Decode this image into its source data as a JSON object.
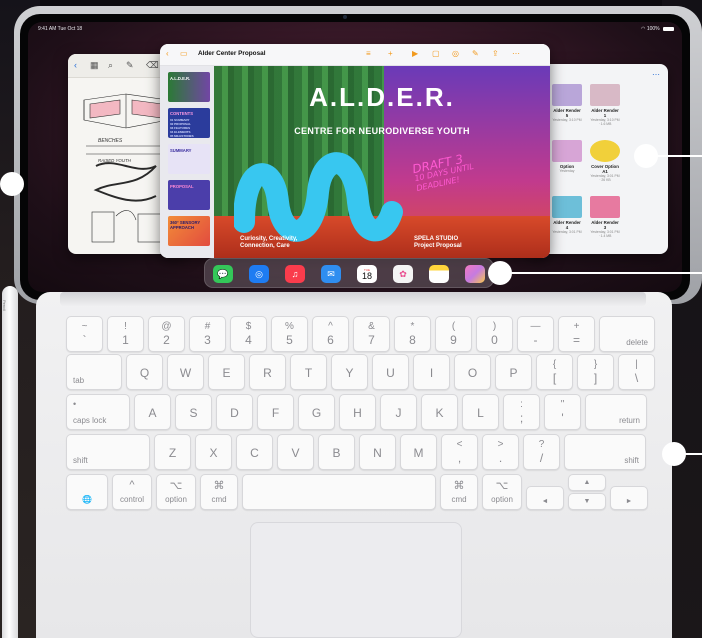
{
  "status_bar": {
    "time": "9:41 AM  Tue Oct 18",
    "battery": "100%"
  },
  "keynote": {
    "title": "Alder Center Proposal",
    "title_badge": "",
    "sidebar": [
      {
        "label": "A.L.D.E.R."
      },
      {
        "label": "CONTENTS",
        "lines": [
          "01 SUMMARY",
          "02 PROPOSAL",
          "03 FEATURES",
          "04 ELEMENTS",
          "05 MILESTONES"
        ]
      },
      {
        "label": "SUMMARY"
      },
      {
        "label": "PROPOSAL"
      },
      {
        "label": "360° SENSORY APPROACH"
      }
    ],
    "slide": {
      "logo": "A.L.D.E.R.",
      "subtitle": "CENTRE FOR NEURODIVERSE YOUTH",
      "draft_lines": [
        "DRAFT 3",
        "10 DAYS UNTIL",
        "DEADLINE!"
      ],
      "left_caption": [
        "Curiosity, Creativity,",
        "Connection, Care"
      ],
      "right_caption": [
        "SPELA STUDIO",
        "Project Proposal"
      ]
    }
  },
  "files": [
    {
      "name": "Alder Render 1",
      "meta": "Yesterday, 3:10 PM · 1.6 MB",
      "color": "#d8b9c6"
    },
    {
      "name": "Alder Render 5",
      "meta": "Yesterday, 3:10 PM",
      "color": "#b9a6d9"
    },
    {
      "name": "Cover Option A1",
      "meta": "Yesterday, 3:01 PM · 26 KB",
      "color": "#f1d03a"
    },
    {
      "name": "Alder Render 3",
      "meta": "Yesterday, 3:01 PM · 1.4 MB",
      "color": "#e77aa0"
    },
    {
      "name": "Alder Render 4",
      "meta": "Yesterday, 3:01 PM",
      "color": "#6dbfd9"
    },
    {
      "name": "Option",
      "meta": "Yesterday",
      "color": "#d7a5d6"
    }
  ],
  "notes_sketch": {
    "labels": [
      "BENCHES",
      "RAISED YOUTH"
    ]
  },
  "dock": {
    "apps": [
      {
        "name": "messages-icon",
        "color": "#34c759",
        "glyph": ""
      },
      {
        "name": "safari-icon",
        "color": "#1e7cf2",
        "glyph": ""
      },
      {
        "name": "music-icon",
        "color": "#fa3c4c",
        "glyph": "♫"
      },
      {
        "name": "mail-icon",
        "color": "#2f8ef0",
        "glyph": "✉"
      },
      {
        "name": "calendar-icon",
        "color": "#ffffff",
        "glyph": "18",
        "day": "TUE"
      },
      {
        "name": "photos-icon",
        "color": "#f4f4f4",
        "glyph": "✿"
      },
      {
        "name": "notes-icon",
        "color": "#ffd43b",
        "glyph": ""
      },
      {
        "name": "app-library-icon",
        "color": "#c57be0",
        "glyph": ""
      }
    ]
  },
  "keyboard": {
    "row1": [
      {
        "top": "~",
        "bot": "`"
      },
      {
        "top": "!",
        "bot": "1"
      },
      {
        "top": "@",
        "bot": "2"
      },
      {
        "top": "#",
        "bot": "3"
      },
      {
        "top": "$",
        "bot": "4"
      },
      {
        "top": "%",
        "bot": "5"
      },
      {
        "top": "^",
        "bot": "6"
      },
      {
        "top": "&",
        "bot": "7"
      },
      {
        "top": "*",
        "bot": "8"
      },
      {
        "top": "(",
        "bot": "9"
      },
      {
        "top": ")",
        "bot": "0"
      },
      {
        "top": "—",
        "bot": "-"
      },
      {
        "top": "+",
        "bot": "="
      },
      {
        "label": "delete"
      }
    ],
    "row2": [
      {
        "label": "tab"
      },
      {
        "main": "Q"
      },
      {
        "main": "W"
      },
      {
        "main": "E"
      },
      {
        "main": "R"
      },
      {
        "main": "T"
      },
      {
        "main": "Y"
      },
      {
        "main": "U"
      },
      {
        "main": "I"
      },
      {
        "main": "O"
      },
      {
        "main": "P"
      },
      {
        "top": "{",
        "bot": "["
      },
      {
        "top": "}",
        "bot": "]"
      },
      {
        "top": "|",
        "bot": "\\"
      }
    ],
    "row3": [
      {
        "label": "caps lock",
        "dot": "•"
      },
      {
        "main": "A"
      },
      {
        "main": "S"
      },
      {
        "main": "D"
      },
      {
        "main": "F"
      },
      {
        "main": "G"
      },
      {
        "main": "H"
      },
      {
        "main": "J"
      },
      {
        "main": "K"
      },
      {
        "main": "L"
      },
      {
        "top": ":",
        "bot": ";"
      },
      {
        "top": "\"",
        "bot": "'"
      },
      {
        "label": "return"
      }
    ],
    "row4": [
      {
        "label": "shift"
      },
      {
        "main": "Z"
      },
      {
        "main": "X"
      },
      {
        "main": "C"
      },
      {
        "main": "V"
      },
      {
        "main": "B"
      },
      {
        "main": "N"
      },
      {
        "main": "M"
      },
      {
        "top": "<",
        "bot": ","
      },
      {
        "top": ">",
        "bot": "."
      },
      {
        "top": "?",
        "bot": "/"
      },
      {
        "label": "shift"
      }
    ],
    "row5": [
      {
        "label": "🌐"
      },
      {
        "sym": "^",
        "label": "control"
      },
      {
        "sym": "⌥",
        "label": "option"
      },
      {
        "sym": "⌘",
        "label": "cmd"
      },
      {
        "label": ""
      },
      {
        "sym": "⌘",
        "label": "cmd"
      },
      {
        "sym": "⌥",
        "label": "option"
      },
      {
        "label": "◄"
      },
      {
        "label": "▲"
      },
      {
        "label": "▼"
      },
      {
        "label": "►"
      }
    ]
  },
  "pencil": {
    "brand": "Pencil"
  }
}
